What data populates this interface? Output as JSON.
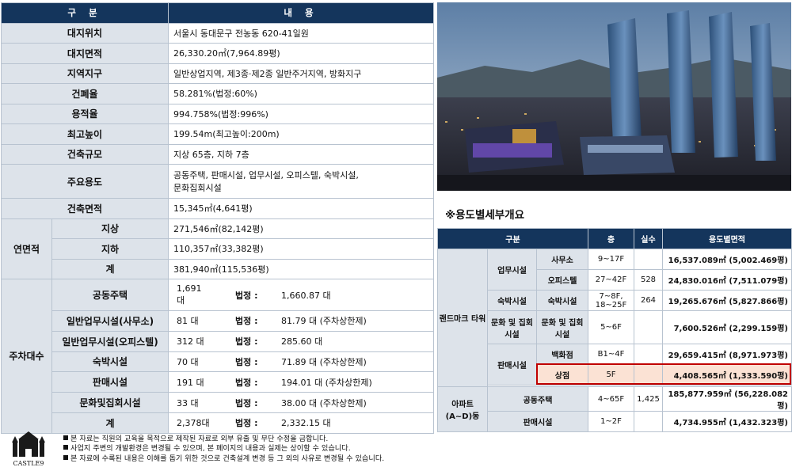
{
  "left_table": {
    "header": {
      "col1": "구 분",
      "col2": "내 용"
    },
    "rows": [
      {
        "label": "대지위치",
        "value": "서울시 동대문구 전농동 620-41일원"
      },
      {
        "label": "대지면적",
        "value": "26,330.20㎡(7,964.89평)"
      },
      {
        "label": "지역지구",
        "value": "일반상업지역, 제3종·제2종 일반주거지역, 방화지구"
      },
      {
        "label": "건폐율",
        "value": "58.281%(법정:60%)"
      },
      {
        "label": "용적율",
        "value": "994.758%(법정:996%)"
      },
      {
        "label": "최고높이",
        "value": "199.54m(최고높이:200m)"
      },
      {
        "label": "건축규모",
        "value": "지상 65층, 지하 7층"
      },
      {
        "label": "주요용도",
        "value": "공동주택, 판매시설, 업무시설, 오피스텔, 숙박시설,",
        "value2": "문화집회시설"
      },
      {
        "label": "건축면적",
        "value": "15,345㎡(4,641평)"
      }
    ],
    "floor_area": {
      "label": "연면적",
      "rows": [
        {
          "label": "지상",
          "value": "271,546㎡(82,142평)"
        },
        {
          "label": "지하",
          "value": "110,357㎡(33,382평)"
        },
        {
          "label": "계",
          "value": "381,940㎡(115,536평)"
        }
      ]
    },
    "parking": {
      "label": "주차대수",
      "rows": [
        {
          "label": "공동주택",
          "count": "1,691",
          "count2": "대",
          "legal_label": "법정 :",
          "legal": "1,660.87 대"
        },
        {
          "label": "일반업무시설(사무소)",
          "count": "81 대",
          "legal_label": "법정 :",
          "legal": "81.79 대 (주차상한제)"
        },
        {
          "label": "일반업무시설(오피스텔)",
          "count": "312 대",
          "legal_label": "법정 :",
          "legal": "285.60 대"
        },
        {
          "label": "숙박시설",
          "count": "70 대",
          "legal_label": "법정 :",
          "legal": "71.89 대 (주차상한제)"
        },
        {
          "label": "판매시설",
          "count": "191 대",
          "legal_label": "법정 :",
          "legal": "194.01 대 (주차상한제)"
        },
        {
          "label": "문화및집회시설",
          "count": "33 대",
          "legal_label": "법정 :",
          "legal": "38.00 대 (주차상한제)"
        },
        {
          "label": "계",
          "count": "2,378대",
          "legal_label": "법정 :",
          "legal": "2,332.15 대"
        }
      ]
    }
  },
  "section_title": "※용도별세부개요",
  "right_table": {
    "headers": {
      "category": "구분",
      "floor": "층",
      "rooms": "실수",
      "area": "용도별면적"
    },
    "landmark": {
      "label": "랜드마크 타워"
    },
    "apartment": {
      "label": "아파트 (A~D)동"
    },
    "office_group": "업무시설",
    "lodging_group": "숙박시설",
    "culture_group": "문화 및 집회 시설",
    "retail_group": "판매시설",
    "rows": {
      "office": {
        "name": "사무소",
        "floor": "9~17F",
        "rooms": "",
        "area": "16,537.089㎡ (5,002.469평)"
      },
      "officetel": {
        "name": "오피스텔",
        "floor": "27~42F",
        "rooms": "528",
        "area": "24,830.016㎡ (7,511.079평)"
      },
      "hotel": {
        "name": "숙박시설",
        "floor": "7~8F, 18~25F",
        "rooms": "264",
        "area": "19,265.676㎡ (5,827.866평)"
      },
      "culture": {
        "name": "문화 및 집회 시설",
        "floor": "5~6F",
        "rooms": "",
        "area": "7,600.526㎡ (2,299.159평)"
      },
      "dept": {
        "name": "백화점",
        "floor": "B1~4F",
        "rooms": "",
        "area": "29,659.415㎡ (8,971.973평)"
      },
      "store": {
        "name": "상점",
        "floor": "5F",
        "rooms": "",
        "area": "4,408.565㎡ (1,333.590평)"
      },
      "apt_house": {
        "name": "공동주택",
        "floor": "4~65F",
        "rooms": "1,425",
        "area": "185,877.959㎡ (56,228.082평)"
      },
      "apt_retail": {
        "name": "판매시설",
        "floor": "1~2F",
        "rooms": "",
        "area": "4,734.955㎡ (1,432.323평)"
      }
    },
    "highlight_color": "#c00000"
  },
  "footer": {
    "logo_text": "CASTLE9",
    "notes": [
      "본 자료는 직원의 교육을 목적으로 제작된 자료로 외부 유출 및 무단 수정을 금합니다.",
      "사업지 주변의 개발환경은 변경될 수 있으며, 본 페이지의 내용과 실제는 상이할 수 있습니다.",
      "본 자료에 수록된 내용은 이해를 돕기 위한 것으로 건축설계 변경 등 그 외의 사유로 변경될 수 있습니다."
    ]
  },
  "colors": {
    "header_navy": "#14355c",
    "label_gray": "#dde3ea",
    "highlight_fill": "#fbe2d4"
  }
}
